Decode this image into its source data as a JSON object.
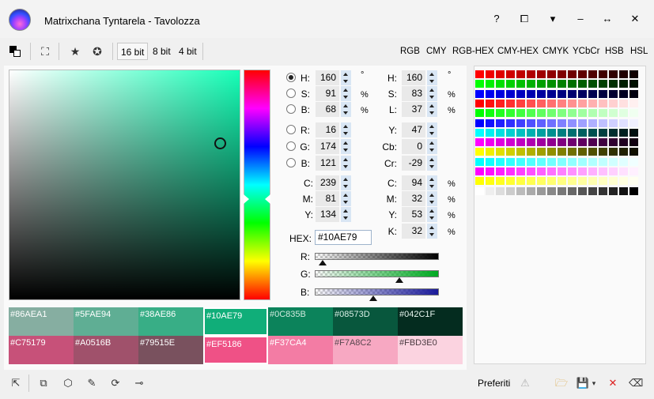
{
  "window": {
    "title": "Matrixchana Tyntarela - Tavolozza",
    "controls": [
      "?",
      "⧠",
      "▾",
      "–",
      "↔",
      "✕"
    ]
  },
  "toolbar": {
    "bit_options": [
      "16 bit",
      "8 bit",
      "4 bit"
    ],
    "modes": [
      "RGB",
      "CMY",
      "RGB-HEX",
      "CMY-HEX",
      "CMYK",
      "YCbCr",
      "HSB",
      "HSL"
    ]
  },
  "left_fields": [
    {
      "label": "H:",
      "value": "160",
      "unit": "°"
    },
    {
      "label": "S:",
      "value": "91",
      "unit": "%"
    },
    {
      "label": "B:",
      "value": "68",
      "unit": "%"
    },
    {
      "label": "R:",
      "value": "16",
      "unit": ""
    },
    {
      "label": "G:",
      "value": "174",
      "unit": ""
    },
    {
      "label": "B:",
      "value": "121",
      "unit": ""
    },
    {
      "label": "C:",
      "value": "239",
      "unit": ""
    },
    {
      "label": "M:",
      "value": "81",
      "unit": ""
    },
    {
      "label": "Y:",
      "value": "134",
      "unit": ""
    }
  ],
  "right_fields": [
    {
      "label": "H:",
      "value": "160",
      "unit": "°"
    },
    {
      "label": "S:",
      "value": "83",
      "unit": "%"
    },
    {
      "label": "L:",
      "value": "37",
      "unit": "%"
    },
    {
      "label": "Y:",
      "value": "47",
      "unit": ""
    },
    {
      "label": "Cb:",
      "value": "0",
      "unit": ""
    },
    {
      "label": "Cr:",
      "value": "-29",
      "unit": ""
    },
    {
      "label": "C:",
      "value": "94",
      "unit": "%"
    },
    {
      "label": "M:",
      "value": "32",
      "unit": "%"
    },
    {
      "label": "Y:",
      "value": "53",
      "unit": "%"
    },
    {
      "label": "K:",
      "value": "32",
      "unit": "%"
    }
  ],
  "hex": {
    "label": "HEX:",
    "value": "#10AE79"
  },
  "sliders": [
    {
      "label": "R:",
      "color": "#000000",
      "value": 16,
      "max": 255
    },
    {
      "label": "G:",
      "color": "#00aa22",
      "value": 174,
      "max": 255
    },
    {
      "label": "B:",
      "color": "#1a1a9a",
      "value": 121,
      "max": 255
    }
  ],
  "swatches_top": [
    {
      "hex": "#86AEA1",
      "text_color": "#ffffff"
    },
    {
      "hex": "#5FAE94",
      "text_color": "#ffffff"
    },
    {
      "hex": "#38AE86",
      "text_color": "#ffffff"
    },
    {
      "hex": "#10AE79",
      "text_color": "#ffffff"
    },
    {
      "hex": "#0C835B",
      "text_color": "#cfe9dd"
    },
    {
      "hex": "#08573D",
      "text_color": "#d8efe6"
    },
    {
      "hex": "#042C1F",
      "text_color": "#e6f5ee"
    }
  ],
  "swatches_bottom": [
    {
      "hex": "#C75179",
      "text_color": "#ffffff"
    },
    {
      "hex": "#A0516B",
      "text_color": "#ffffff"
    },
    {
      "hex": "#79515E",
      "text_color": "#ffffff"
    },
    {
      "hex": "#EF5186",
      "text_color": "#ffffff"
    },
    {
      "hex": "#F37CA4",
      "text_color": "#ffffff"
    },
    {
      "hex": "#F7A8C2",
      "text_color": "#5a4850"
    },
    {
      "hex": "#FBD3E0",
      "text_color": "#4a3a40"
    }
  ],
  "palette": {
    "rows": [
      [
        "#ff0000",
        "#f00000",
        "#e00000",
        "#d00000",
        "#c00000",
        "#b00000",
        "#a00000",
        "#900000",
        "#800000",
        "#700000",
        "#600000",
        "#500000",
        "#400000",
        "#300000",
        "#200000",
        "#100000"
      ],
      [
        "#00ff00",
        "#00f000",
        "#00e000",
        "#00d000",
        "#00c000",
        "#00b000",
        "#00a000",
        "#009000",
        "#008000",
        "#007000",
        "#006000",
        "#005000",
        "#004000",
        "#003000",
        "#002000",
        "#001000"
      ],
      [
        "#0000ff",
        "#0000f0",
        "#0000e0",
        "#0000d0",
        "#0000c0",
        "#0000b0",
        "#0000a0",
        "#000090",
        "#000080",
        "#000070",
        "#000060",
        "#000050",
        "#000040",
        "#000030",
        "#000020",
        "#000010"
      ],
      [
        "#ff0000",
        "#ff1010",
        "#ff2020",
        "#ff3030",
        "#ff4040",
        "#ff5050",
        "#ff6060",
        "#ff7070",
        "#ff8080",
        "#ff9090",
        "#ffa0a0",
        "#ffb0b0",
        "#ffc0c0",
        "#ffd0d0",
        "#ffe0e0",
        "#fff0f0"
      ],
      [
        "#00ff00",
        "#10ff10",
        "#20ff20",
        "#30ff30",
        "#40ff40",
        "#50ff50",
        "#60ff60",
        "#70ff70",
        "#80ff80",
        "#90ff90",
        "#a0ffa0",
        "#b0ffb0",
        "#c0ffc0",
        "#d0ffd0",
        "#e0ffe0",
        "#f0fff0"
      ],
      [
        "#0000ff",
        "#1010ff",
        "#2020ff",
        "#3030ff",
        "#4040ff",
        "#5050ff",
        "#6060ff",
        "#7070ff",
        "#8080ff",
        "#9090ff",
        "#a0a0ff",
        "#b0b0ff",
        "#c0c0ff",
        "#d0d0ff",
        "#e0e0ff",
        "#f0f0ff"
      ],
      [
        "#00ffff",
        "#00f0f0",
        "#00e0e0",
        "#00d0d0",
        "#00c0c0",
        "#00b0b0",
        "#00a0a0",
        "#009090",
        "#008080",
        "#007070",
        "#006060",
        "#005050",
        "#004040",
        "#003030",
        "#002020",
        "#001010"
      ],
      [
        "#ff00ff",
        "#f000f0",
        "#e000e0",
        "#d000d0",
        "#c000c0",
        "#b000b0",
        "#a000a0",
        "#900090",
        "#800080",
        "#700070",
        "#600060",
        "#500050",
        "#400040",
        "#300030",
        "#200020",
        "#100010"
      ],
      [
        "#ffff00",
        "#f0f000",
        "#e0e000",
        "#d0d000",
        "#c0c000",
        "#b0b000",
        "#a0a000",
        "#909000",
        "#808000",
        "#707000",
        "#606000",
        "#505000",
        "#404000",
        "#303000",
        "#202000",
        "#101000"
      ],
      [
        "#00ffff",
        "#10ffff",
        "#20ffff",
        "#30ffff",
        "#40ffff",
        "#50ffff",
        "#60ffff",
        "#70ffff",
        "#80ffff",
        "#90ffff",
        "#a0ffff",
        "#b0ffff",
        "#c0ffff",
        "#d0ffff",
        "#e0ffff",
        "#f0ffff"
      ],
      [
        "#ff00ff",
        "#ff10ff",
        "#ff20ff",
        "#ff30ff",
        "#ff40ff",
        "#ff50ff",
        "#ff60ff",
        "#ff70ff",
        "#ff80ff",
        "#ff90ff",
        "#ffa0ff",
        "#ffb0ff",
        "#ffc0ff",
        "#ffd0ff",
        "#ffe0ff",
        "#fff0ff"
      ],
      [
        "#ffff00",
        "#ffff10",
        "#ffff20",
        "#ffff30",
        "#ffff40",
        "#ffff50",
        "#ffff60",
        "#ffff70",
        "#ffff80",
        "#ffff90",
        "#ffffa0",
        "#ffffb0",
        "#ffffc0",
        "#ffffd0",
        "#ffffe0",
        "#fffff0"
      ],
      [
        "#ffffff",
        "#eeeeee",
        "#dddddd",
        "#cccccc",
        "#bbbbbb",
        "#aaaaaa",
        "#999999",
        "#888888",
        "#777777",
        "#666666",
        "#555555",
        "#444444",
        "#333333",
        "#222222",
        "#111111",
        "#000000"
      ]
    ]
  },
  "favorites": {
    "label": "Preferiti"
  },
  "current_color": "#10AE79"
}
